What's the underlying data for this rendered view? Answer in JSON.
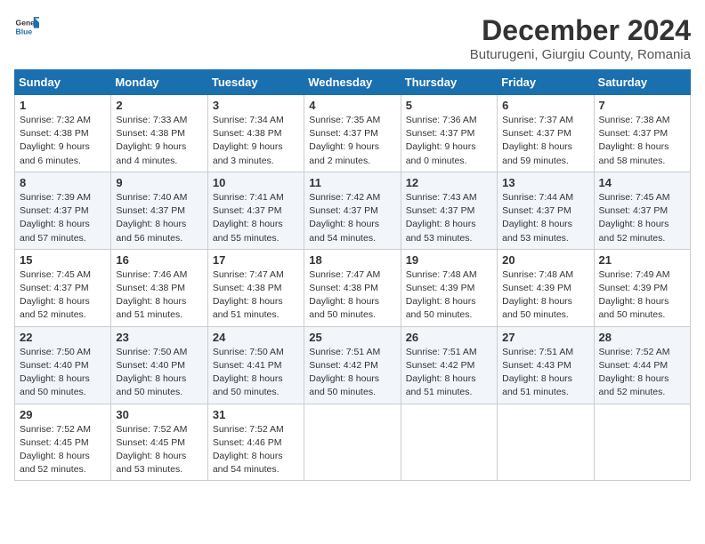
{
  "header": {
    "logo_general": "General",
    "logo_blue": "Blue",
    "title": "December 2024",
    "location": "Buturugeni, Giurgiu County, Romania"
  },
  "columns": [
    "Sunday",
    "Monday",
    "Tuesday",
    "Wednesday",
    "Thursday",
    "Friday",
    "Saturday"
  ],
  "weeks": [
    [
      {
        "day": "1",
        "lines": [
          "Sunrise: 7:32 AM",
          "Sunset: 4:38 PM",
          "Daylight: 9 hours",
          "and 6 minutes."
        ]
      },
      {
        "day": "2",
        "lines": [
          "Sunrise: 7:33 AM",
          "Sunset: 4:38 PM",
          "Daylight: 9 hours",
          "and 4 minutes."
        ]
      },
      {
        "day": "3",
        "lines": [
          "Sunrise: 7:34 AM",
          "Sunset: 4:38 PM",
          "Daylight: 9 hours",
          "and 3 minutes."
        ]
      },
      {
        "day": "4",
        "lines": [
          "Sunrise: 7:35 AM",
          "Sunset: 4:37 PM",
          "Daylight: 9 hours",
          "and 2 minutes."
        ]
      },
      {
        "day": "5",
        "lines": [
          "Sunrise: 7:36 AM",
          "Sunset: 4:37 PM",
          "Daylight: 9 hours",
          "and 0 minutes."
        ]
      },
      {
        "day": "6",
        "lines": [
          "Sunrise: 7:37 AM",
          "Sunset: 4:37 PM",
          "Daylight: 8 hours",
          "and 59 minutes."
        ]
      },
      {
        "day": "7",
        "lines": [
          "Sunrise: 7:38 AM",
          "Sunset: 4:37 PM",
          "Daylight: 8 hours",
          "and 58 minutes."
        ]
      }
    ],
    [
      {
        "day": "8",
        "lines": [
          "Sunrise: 7:39 AM",
          "Sunset: 4:37 PM",
          "Daylight: 8 hours",
          "and 57 minutes."
        ]
      },
      {
        "day": "9",
        "lines": [
          "Sunrise: 7:40 AM",
          "Sunset: 4:37 PM",
          "Daylight: 8 hours",
          "and 56 minutes."
        ]
      },
      {
        "day": "10",
        "lines": [
          "Sunrise: 7:41 AM",
          "Sunset: 4:37 PM",
          "Daylight: 8 hours",
          "and 55 minutes."
        ]
      },
      {
        "day": "11",
        "lines": [
          "Sunrise: 7:42 AM",
          "Sunset: 4:37 PM",
          "Daylight: 8 hours",
          "and 54 minutes."
        ]
      },
      {
        "day": "12",
        "lines": [
          "Sunrise: 7:43 AM",
          "Sunset: 4:37 PM",
          "Daylight: 8 hours",
          "and 53 minutes."
        ]
      },
      {
        "day": "13",
        "lines": [
          "Sunrise: 7:44 AM",
          "Sunset: 4:37 PM",
          "Daylight: 8 hours",
          "and 53 minutes."
        ]
      },
      {
        "day": "14",
        "lines": [
          "Sunrise: 7:45 AM",
          "Sunset: 4:37 PM",
          "Daylight: 8 hours",
          "and 52 minutes."
        ]
      }
    ],
    [
      {
        "day": "15",
        "lines": [
          "Sunrise: 7:45 AM",
          "Sunset: 4:37 PM",
          "Daylight: 8 hours",
          "and 52 minutes."
        ]
      },
      {
        "day": "16",
        "lines": [
          "Sunrise: 7:46 AM",
          "Sunset: 4:38 PM",
          "Daylight: 8 hours",
          "and 51 minutes."
        ]
      },
      {
        "day": "17",
        "lines": [
          "Sunrise: 7:47 AM",
          "Sunset: 4:38 PM",
          "Daylight: 8 hours",
          "and 51 minutes."
        ]
      },
      {
        "day": "18",
        "lines": [
          "Sunrise: 7:47 AM",
          "Sunset: 4:38 PM",
          "Daylight: 8 hours",
          "and 50 minutes."
        ]
      },
      {
        "day": "19",
        "lines": [
          "Sunrise: 7:48 AM",
          "Sunset: 4:39 PM",
          "Daylight: 8 hours",
          "and 50 minutes."
        ]
      },
      {
        "day": "20",
        "lines": [
          "Sunrise: 7:48 AM",
          "Sunset: 4:39 PM",
          "Daylight: 8 hours",
          "and 50 minutes."
        ]
      },
      {
        "day": "21",
        "lines": [
          "Sunrise: 7:49 AM",
          "Sunset: 4:39 PM",
          "Daylight: 8 hours",
          "and 50 minutes."
        ]
      }
    ],
    [
      {
        "day": "22",
        "lines": [
          "Sunrise: 7:50 AM",
          "Sunset: 4:40 PM",
          "Daylight: 8 hours",
          "and 50 minutes."
        ]
      },
      {
        "day": "23",
        "lines": [
          "Sunrise: 7:50 AM",
          "Sunset: 4:40 PM",
          "Daylight: 8 hours",
          "and 50 minutes."
        ]
      },
      {
        "day": "24",
        "lines": [
          "Sunrise: 7:50 AM",
          "Sunset: 4:41 PM",
          "Daylight: 8 hours",
          "and 50 minutes."
        ]
      },
      {
        "day": "25",
        "lines": [
          "Sunrise: 7:51 AM",
          "Sunset: 4:42 PM",
          "Daylight: 8 hours",
          "and 50 minutes."
        ]
      },
      {
        "day": "26",
        "lines": [
          "Sunrise: 7:51 AM",
          "Sunset: 4:42 PM",
          "Daylight: 8 hours",
          "and 51 minutes."
        ]
      },
      {
        "day": "27",
        "lines": [
          "Sunrise: 7:51 AM",
          "Sunset: 4:43 PM",
          "Daylight: 8 hours",
          "and 51 minutes."
        ]
      },
      {
        "day": "28",
        "lines": [
          "Sunrise: 7:52 AM",
          "Sunset: 4:44 PM",
          "Daylight: 8 hours",
          "and 52 minutes."
        ]
      }
    ],
    [
      {
        "day": "29",
        "lines": [
          "Sunrise: 7:52 AM",
          "Sunset: 4:45 PM",
          "Daylight: 8 hours",
          "and 52 minutes."
        ]
      },
      {
        "day": "30",
        "lines": [
          "Sunrise: 7:52 AM",
          "Sunset: 4:45 PM",
          "Daylight: 8 hours",
          "and 53 minutes."
        ]
      },
      {
        "day": "31",
        "lines": [
          "Sunrise: 7:52 AM",
          "Sunset: 4:46 PM",
          "Daylight: 8 hours",
          "and 54 minutes."
        ]
      },
      null,
      null,
      null,
      null
    ]
  ]
}
